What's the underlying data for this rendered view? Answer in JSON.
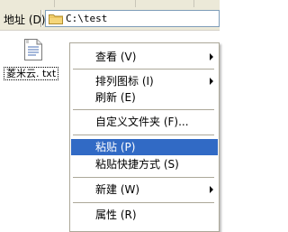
{
  "address_bar": {
    "label": "地址 (D)",
    "path": "C:\\test"
  },
  "file": {
    "name": "菱米云. txt",
    "icon": "text-file-icon"
  },
  "context_menu": {
    "items": [
      {
        "label": "查看 (V)",
        "submenu": true
      },
      {
        "label": "排列图标 (I)",
        "submenu": true
      },
      {
        "label": "刷新 (E)",
        "submenu": false
      },
      {
        "label": "自定义文件夹 (F)...",
        "submenu": false
      },
      {
        "label": "粘贴 (P)",
        "submenu": false,
        "highlighted": true
      },
      {
        "label": "粘贴快捷方式 (S)",
        "submenu": false
      },
      {
        "label": "新建 (W)",
        "submenu": true
      },
      {
        "label": "属性 (R)",
        "submenu": false
      }
    ]
  },
  "colors": {
    "chrome": "#ece9d8",
    "highlight": "#316ac5",
    "field_border": "#7f9db9"
  }
}
